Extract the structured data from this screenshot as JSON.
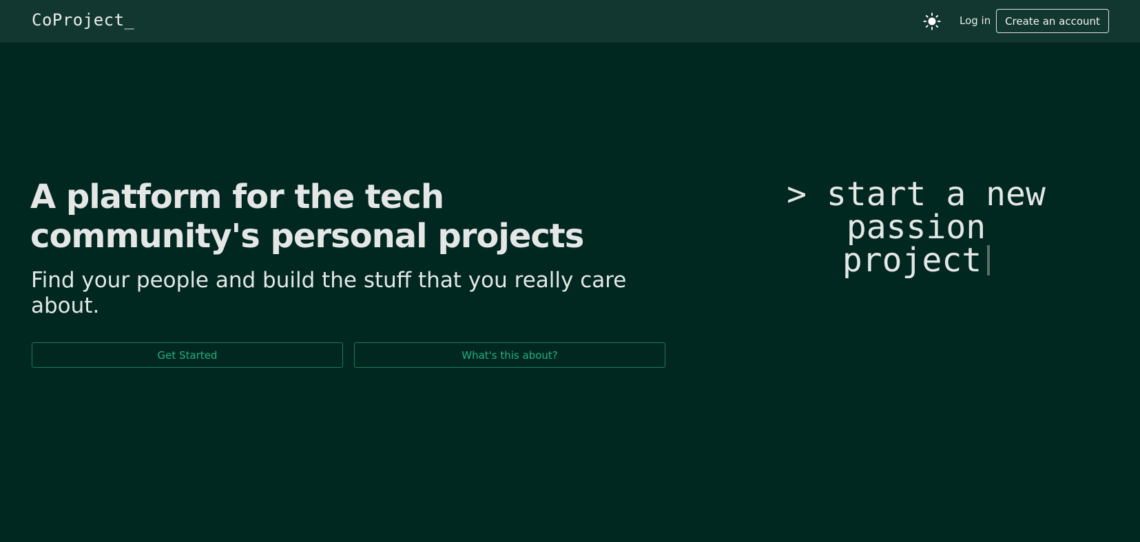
{
  "navbar": {
    "logo": "CoProject_",
    "theme_icon": "sun-icon",
    "login_label": "Log in",
    "create_account_label": "Create an account"
  },
  "hero": {
    "title": "A platform for the tech community's personal projects",
    "subtitle": "Find your people and build the stuff that you really care about.",
    "primary_button": "Get Started",
    "secondary_button": "What's this about?"
  },
  "terminal": {
    "lines": [
      "> start a new",
      "passion",
      "project"
    ]
  },
  "colors": {
    "background": "#012820",
    "navbar": "#123730",
    "accent": "#25b07f",
    "text": "#e4e7e6"
  }
}
